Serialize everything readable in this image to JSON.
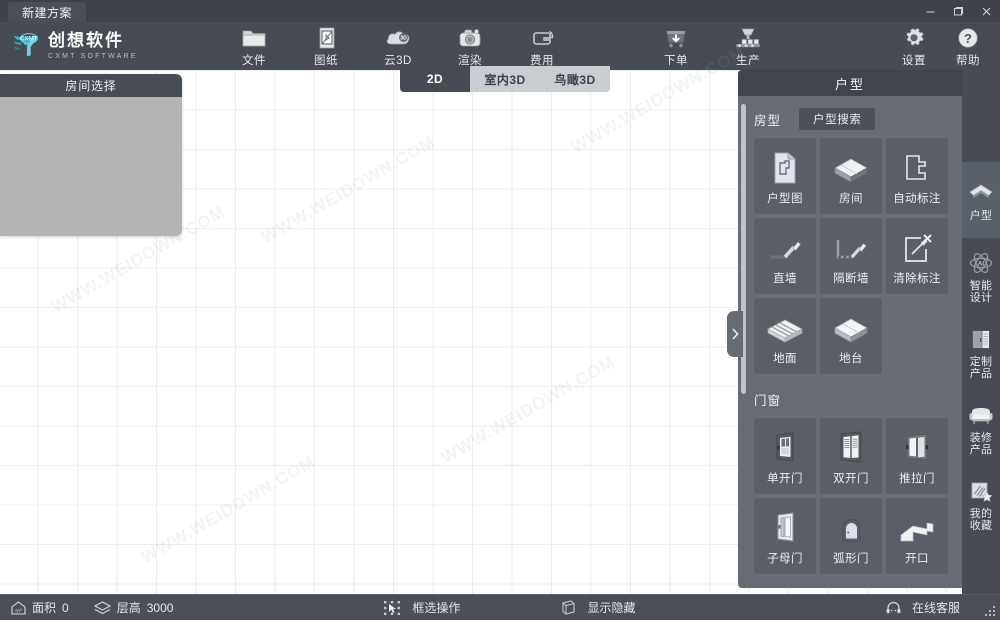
{
  "titlebar": {
    "tab_label": "新建方案",
    "minimize": "minimize",
    "restore": "restore",
    "close": "close"
  },
  "brand": {
    "name_cn": "创想软件",
    "name_en": "CXMT SOFTWARE",
    "mark": "CXMT",
    "accent": "#2fd0e8"
  },
  "toolbar": {
    "items": [
      {
        "label": "文件",
        "icon": "folder-icon"
      },
      {
        "label": "图纸",
        "icon": "blueprint-icon"
      },
      {
        "label": "云3D",
        "icon": "cloud-3d-icon"
      },
      {
        "label": "渲染",
        "icon": "camera-icon"
      },
      {
        "label": "费用",
        "icon": "wallet-refresh-icon"
      },
      {
        "label": "下单",
        "icon": "order-cart-icon"
      },
      {
        "label": "生产",
        "icon": "production-icon"
      }
    ],
    "right_items": [
      {
        "label": "设置",
        "icon": "gear-icon"
      },
      {
        "label": "帮助",
        "icon": "help-icon"
      }
    ]
  },
  "view_tabs": {
    "items": [
      {
        "label": "2D",
        "active": true
      },
      {
        "label": "室内3D",
        "active": false
      },
      {
        "label": "鸟瞰3D",
        "active": false
      }
    ]
  },
  "room_panel": {
    "title": "房间选择"
  },
  "right_panel": {
    "title": "户型",
    "collapse_icon": "chevron-right-icon",
    "sections": [
      {
        "title": "房型",
        "button": "户型搜索",
        "items": [
          {
            "label": "户型图",
            "icon": "floorplan-icon"
          },
          {
            "label": "房间",
            "icon": "room-box-icon"
          },
          {
            "label": "自动标注",
            "icon": "auto-dimension-icon"
          },
          {
            "label": "直墙",
            "icon": "straight-wall-icon"
          },
          {
            "label": "隔断墙",
            "icon": "partition-wall-icon"
          },
          {
            "label": "清除标注",
            "icon": "clear-dimension-icon"
          },
          {
            "label": "地面",
            "icon": "floor-icon"
          },
          {
            "label": "地台",
            "icon": "platform-icon"
          }
        ]
      },
      {
        "title": "门窗",
        "button": "",
        "items": [
          {
            "label": "单开门",
            "icon": "single-door-icon"
          },
          {
            "label": "双开门",
            "icon": "double-door-icon"
          },
          {
            "label": "推拉门",
            "icon": "sliding-door-icon"
          },
          {
            "label": "子母门",
            "icon": "unequal-door-icon"
          },
          {
            "label": "弧形门",
            "icon": "arched-door-icon"
          },
          {
            "label": "开口",
            "icon": "opening-icon"
          }
        ]
      }
    ]
  },
  "sidebar": {
    "items": [
      {
        "label": "户型",
        "icon": "house-chevron-icon",
        "active": true
      },
      {
        "label": "智能\n设计",
        "line1": "智能",
        "line2": "设计",
        "icon": "ai-atom-icon",
        "active": false
      },
      {
        "label": "定制\n产品",
        "line1": "定制",
        "line2": "产品",
        "icon": "cabinet-icon",
        "active": false
      },
      {
        "label": "装修\n产品",
        "line1": "装修",
        "line2": "产品",
        "icon": "sofa-icon",
        "active": false
      },
      {
        "label": "我的\n收藏",
        "line1": "我的",
        "line2": "收藏",
        "icon": "favorite-star-icon",
        "active": false
      }
    ]
  },
  "status": {
    "area_label": "面积",
    "area_value": "0",
    "height_label": "层高",
    "height_value": "3000",
    "select_mode": "框选操作",
    "show_hide": "显示隐藏",
    "support": "在线客服"
  },
  "watermark": "WWW.WEIDOWN.COM"
}
